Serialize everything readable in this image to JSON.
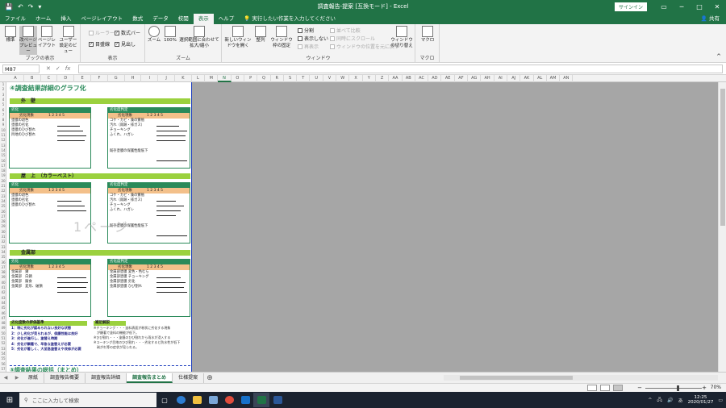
{
  "window": {
    "title": "調査報告-提案 [互換モード] - Excel",
    "signin": "サインイン",
    "share": "共有"
  },
  "qat": {
    "save_icon": "save-icon",
    "undo_icon": "undo-icon",
    "redo_icon": "redo-icon"
  },
  "tabs": [
    "ファイル",
    "ホーム",
    "挿入",
    "ページレイアウト",
    "数式",
    "データ",
    "校閲",
    "表示",
    "ヘルプ"
  ],
  "active_tab": "表示",
  "tellme": "実行したい作業を入力してください",
  "ribbon": {
    "group_views": {
      "label": "ブックの表示",
      "normal": "標準",
      "pagebreak": "改ページプレビュー",
      "pagelayout": "ページレイアウト",
      "custom": "ユーザー設定のビュー"
    },
    "group_show": {
      "label": "表示",
      "ruler": "ルーラー",
      "formula_bar": "数式バー",
      "gridlines": "目盛線",
      "headings": "見出し"
    },
    "group_zoom": {
      "label": "ズーム",
      "zoom": "ズーム",
      "zoom100": "100%",
      "zoom_sel": "選択範囲に合わせて拡大/縮小"
    },
    "group_window": {
      "label": "ウィンドウ",
      "new_window": "新しいウィンドウを開く",
      "arrange": "整列",
      "freeze": "ウィンドウ枠の固定",
      "split": "分割",
      "hide": "表示しない",
      "unhide": "再表示",
      "side_by_side": "並べて比較",
      "sync_scroll": "同時にスクロール",
      "reset_pos": "ウィンドウの位置を元に戻す",
      "switch": "ウィンドウの切り替え"
    },
    "group_macro": {
      "label": "マクロ",
      "macro": "マクロ"
    }
  },
  "formula": {
    "namebox": "M87",
    "fx": "fx"
  },
  "columns": [
    "A",
    "B",
    "C",
    "D",
    "E",
    "F",
    "G",
    "H",
    "I",
    "J",
    "K",
    "L",
    "M",
    "N",
    "O",
    "P",
    "Q",
    "R",
    "S",
    "T",
    "U",
    "V",
    "W",
    "X",
    "Y",
    "Z",
    "AA",
    "AB",
    "AC",
    "AD",
    "AE",
    "AF",
    "AG",
    "AH",
    "AI",
    "AJ",
    "AK",
    "AL",
    "AM",
    "AN"
  ],
  "selected_column": "N",
  "rows": [
    "1",
    "2",
    "3",
    "4",
    "5",
    "6",
    "7",
    "8",
    "9",
    "10",
    "11",
    "12",
    "13",
    "14",
    "15",
    "16",
    "17",
    "18",
    "19",
    "20",
    "21",
    "22",
    "23",
    "24",
    "25",
    "26",
    "27",
    "28",
    "29",
    "30",
    "31",
    "32",
    "33",
    "34",
    "35",
    "36",
    "37",
    "38",
    "39",
    "40",
    "41",
    "42",
    "43",
    "44",
    "45",
    "46",
    "47",
    "48",
    "49",
    "50",
    "51",
    "52",
    "53",
    "54",
    "55",
    "56",
    "57"
  ],
  "sheet": {
    "heading": "④調査結果詳細のグラフ化",
    "section1": "外　壁",
    "section2": "屋　上　（カラーベスト）",
    "section3": "金属部",
    "box_header_left": "劣化",
    "box_header_right": "劣化度判定",
    "col_label": "劣化現象",
    "scale": "1 2 3 4 5",
    "wall_left": [
      "塗膜の退色",
      "塗膜の劣化",
      "塗膜のひび割れ",
      "目地のひび割れ"
    ],
    "wall_right": [
      "コケ・カビ・藻の繁殖",
      "汚れ（雨跡・排ガス）",
      "チョーキング",
      "ふくれ、ハガレ",
      "既存塗膜の保護性能低下"
    ],
    "roof_left": [
      "塗膜の退色",
      "塗膜の劣化",
      "塗膜のひび割れ"
    ],
    "roof_right": [
      "コケ・カビ・藻の繁殖",
      "汚れ（雨跡・排ガス）",
      "チョーキング",
      "ふくれ、ハガレ",
      "既存塗膜の保護性能低下"
    ],
    "metal_left": [
      "金属部　錆",
      "金属部　白錆",
      "金属部　腐食",
      "金属部　変形、破損"
    ],
    "metal_right": [
      "金属部塗膜 変色・色むら",
      "金属部塗膜 チョーキング",
      "金属部塗膜 劣化",
      "金属部塗膜 ひび割れ"
    ],
    "legend_title": "劣化度数の評価基準",
    "legend": [
      "1：特に劣化が認められない良好な状態",
      "2：少し劣化が見られるが、保護性能は良好",
      "3：劣化が進行し、塗替え時期",
      "4：劣化が顕著で、早急な塗替えが必要",
      "5：劣化が著しく、大至急塗替えや改修が必要"
    ],
    "notes_title": "補足解説",
    "notes": [
      "※チョーキング・・・塗料表面が粉状に劣化する現象",
      "　が顕著で塗料の機能が低下。",
      "※ひび割れ・・・塗膜のひび割れから雨水が浸入する",
      "※コーキング目地のひび割れ・・・劣化すると防水性が低下",
      "　剥がれ等の症状が見られる。"
    ],
    "page_watermark": "1ページ",
    "next_heading": "⑤調査結果の総括（まとめ）"
  },
  "sheet_tabs": [
    "原紙",
    "調査報告概要",
    "調査報告詳細",
    "調査報告まとめ",
    "仕様提案"
  ],
  "active_sheet": "調査報告まとめ",
  "status": {
    "zoom": "70%"
  },
  "taskbar": {
    "search": "ここに入力して検索",
    "time": "12:25",
    "date": "2020/01/27"
  }
}
